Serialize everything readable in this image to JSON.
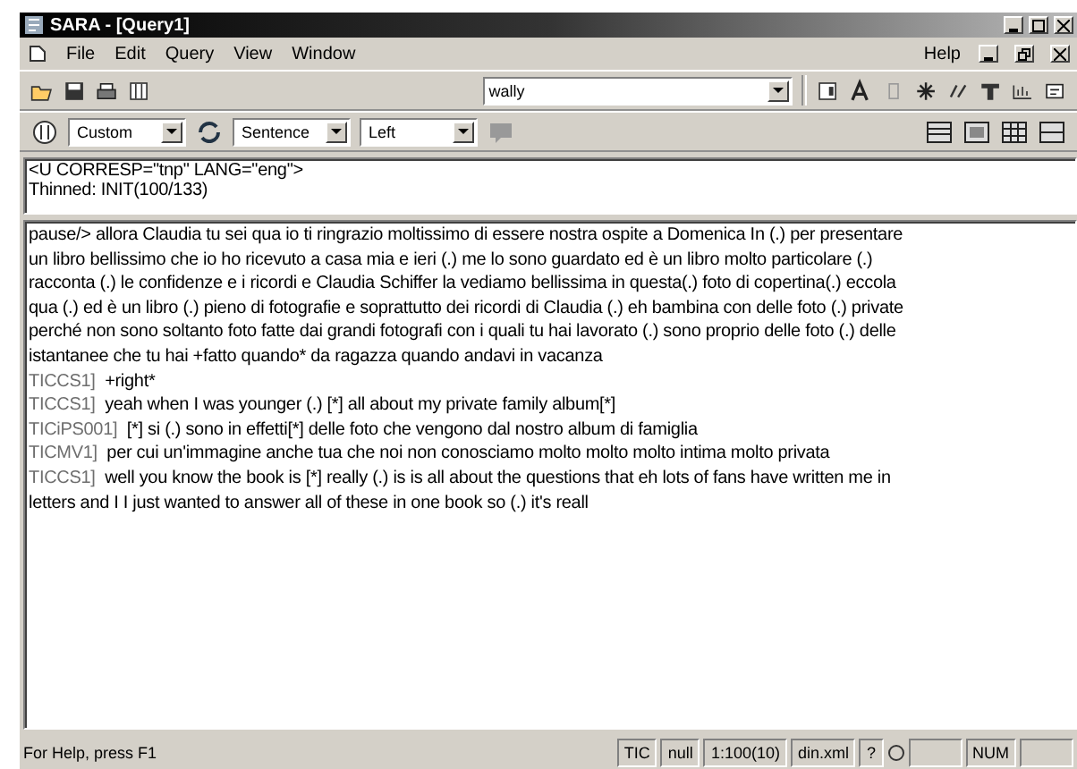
{
  "window": {
    "title": "SARA - [Query1]"
  },
  "menu": [
    {
      "label": "File"
    },
    {
      "label": "Edit"
    },
    {
      "label": "Query"
    },
    {
      "label": "View"
    },
    {
      "label": "Window"
    }
  ],
  "help_menu": {
    "label": "Help"
  },
  "search": {
    "value": "wally"
  },
  "toolbar2": {
    "display": "Custom",
    "unit": "Sentence",
    "align": "Left"
  },
  "header_pane": {
    "lines": [
      "<U CORRESP=\"tnp\" LANG=\"eng\">",
      "Thinned: INIT(100/133)"
    ]
  },
  "text_pane": {
    "lines": [
      {
        "text": "pause/> allora Claudia tu sei qua io ti ringrazio moltissimo di essere nostra ospite a Domenica In (.) per presentare"
      },
      {
        "text": "un libro bellissimo che io ho ricevuto a casa mia e ieri (.) me lo sono guardato ed è un libro molto particolare (.)"
      },
      {
        "text": "racconta (.) le confidenze e i ricordi e Claudia Schiffer la vediamo bellissima in questa(.) foto di copertina(.) eccola"
      },
      {
        "text": "qua (.) ed è un libro (.) pieno di fotografie e soprattutto dei ricordi di Claudia (.) eh bambina con delle foto (.) private"
      },
      {
        "text": "perché non sono soltanto foto fatte dai grandi fotografi con i quali tu hai lavorato (.) sono proprio delle foto (.) delle"
      },
      {
        "text": "istantanee che tu hai +fatto quando* da ragazza quando andavi in vacanza"
      },
      {
        "speaker": "TICCS1]",
        "text": "+right*"
      },
      {
        "speaker": "TICCS1]",
        "text": "yeah when I was younger (.) [*] all about my private family album[*]"
      },
      {
        "speaker": "TICiPS001]",
        "text": "[*] si (.) sono in effetti[*]  delle foto che vengono dal nostro album di famiglia"
      },
      {
        "speaker": "TICMV1]",
        "text": "per cui un'immagine anche tua che noi non conosciamo molto molto molto intima molto privata"
      },
      {
        "speaker": "TICCS1]",
        "text": "well you know the book is [*] really (.) is is all about the questions that eh lots of fans have written me in"
      },
      {
        "text": "letters and I I just wanted to answer all of these in one book so (.) it's reall"
      }
    ]
  },
  "status_bar": {
    "message": "For Help, press F1",
    "panes": [
      "TIC",
      "null",
      "1:100(10)",
      "din.xml",
      "?"
    ],
    "num": "NUM"
  }
}
